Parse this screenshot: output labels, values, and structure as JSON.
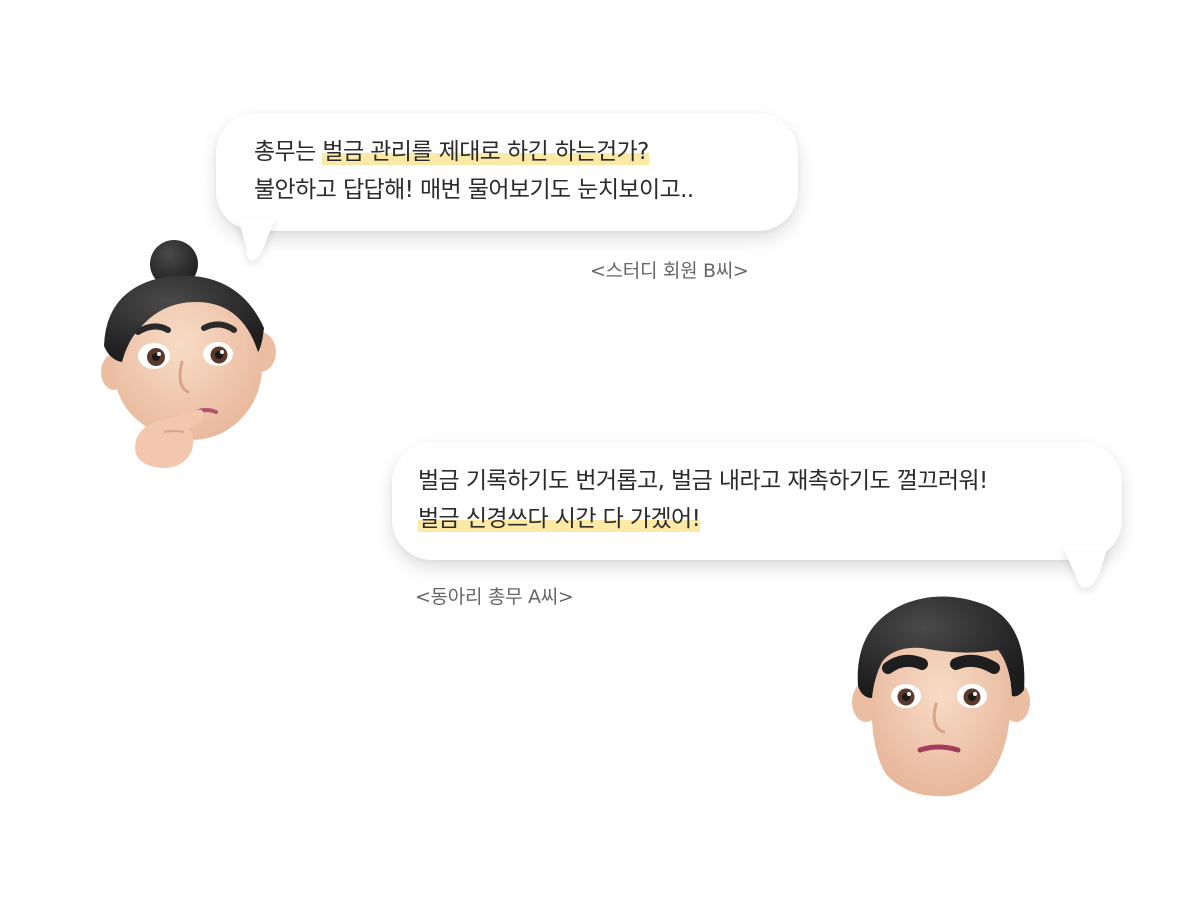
{
  "conversation": [
    {
      "speaker": "<스터디 회원 B씨>",
      "lines": [
        {
          "plain": "총무는 ",
          "highlight": "벌금 관리를 제대로 하긴 하는건가?",
          "rest": ""
        },
        {
          "plain": "불안하고 답답해! 매번 물어보기도 눈치보이고..",
          "highlight": "",
          "rest": ""
        }
      ],
      "avatar": "woman-thinking-avatar"
    },
    {
      "speaker": "<동아리 총무 A씨>",
      "lines": [
        {
          "plain": "벌금 기록하기도 번거롭고, 벌금 내라고 재촉하기도 껄끄러워!",
          "highlight": "",
          "rest": ""
        },
        {
          "plain": "",
          "highlight": "벌금 신경쓰다 시간 다 가겠어!",
          "rest": ""
        }
      ],
      "avatar": "man-concerned-avatar"
    }
  ],
  "colors": {
    "highlight": "#fde9a6",
    "text": "#2b2b2b",
    "caption": "#666666",
    "hair": "#2a2a2a",
    "skin": "#f3cfb6"
  }
}
